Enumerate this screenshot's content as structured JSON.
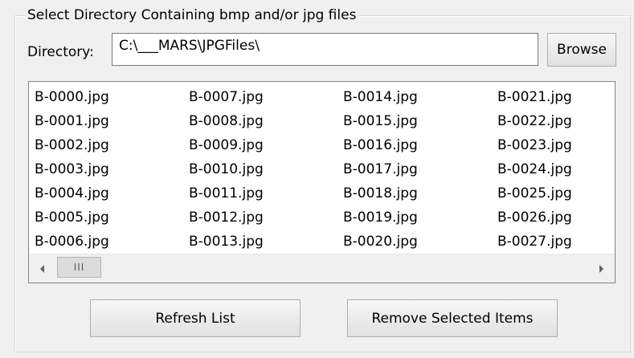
{
  "group": {
    "title": "Select Directory Containing bmp and/or jpg files"
  },
  "directory": {
    "label": "Directory:",
    "value": "C:\\___MARS\\JPGFiles\\"
  },
  "buttons": {
    "browse": "Browse",
    "refresh": "Refresh List",
    "remove": "Remove Selected Items"
  },
  "file_list": {
    "columns": [
      {
        "items": [
          "B-0000.jpg",
          "B-0001.jpg",
          "B-0002.jpg",
          "B-0003.jpg",
          "B-0004.jpg",
          "B-0005.jpg",
          "B-0006.jpg"
        ]
      },
      {
        "items": [
          "B-0007.jpg",
          "B-0008.jpg",
          "B-0009.jpg",
          "B-0010.jpg",
          "B-0011.jpg",
          "B-0012.jpg",
          "B-0013.jpg"
        ]
      },
      {
        "items": [
          "B-0014.jpg",
          "B-0015.jpg",
          "B-0016.jpg",
          "B-0017.jpg",
          "B-0018.jpg",
          "B-0019.jpg",
          "B-0020.jpg"
        ]
      },
      {
        "items": [
          "B-0021.jpg",
          "B-0022.jpg",
          "B-0023.jpg",
          "B-0024.jpg",
          "B-0025.jpg",
          "B-0026.jpg",
          "B-0027.jpg"
        ]
      }
    ]
  },
  "scrollbar": {
    "thumb_grip": "III",
    "left_arrow_icon": "triangle-left",
    "right_arrow_icon": "triangle-right"
  }
}
